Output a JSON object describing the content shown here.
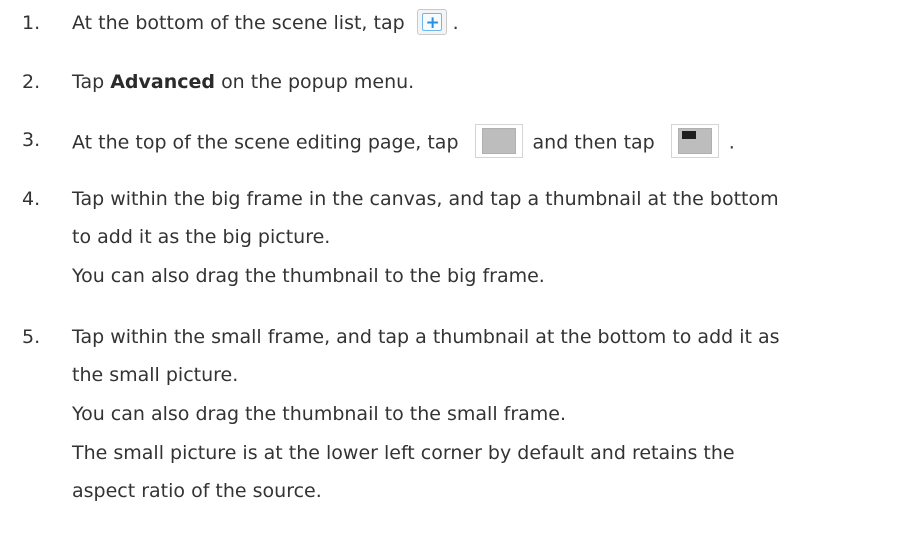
{
  "steps": [
    {
      "number": "1.",
      "text_before": "At the bottom of the scene list, tap",
      "text_after": ".",
      "icon": "add-scene-button-icon"
    },
    {
      "number": "2.",
      "text_before": "Tap",
      "bold": "Advanced",
      "text_after": "on the popup menu."
    },
    {
      "number": "3.",
      "text_before": "At the top of the scene editing page, tap",
      "text_middle": "and then tap",
      "text_after": ".",
      "icons": [
        "layout-blank-icon",
        "layout-picture-in-picture-icon"
      ]
    },
    {
      "number": "4.",
      "lines": [
        "Tap within the big frame in the canvas, and tap a thumbnail at the bottom",
        "to add it as the big picture.",
        "You can also drag the thumbnail to the big frame."
      ]
    },
    {
      "number": "5.",
      "lines": [
        "Tap within the small frame, and tap a thumbnail at the bottom to add it as",
        "the small picture.",
        "You can also drag the thumbnail to the small frame.",
        "The small picture is at the lower left corner by default and retains the",
        "aspect ratio of the source."
      ]
    }
  ]
}
